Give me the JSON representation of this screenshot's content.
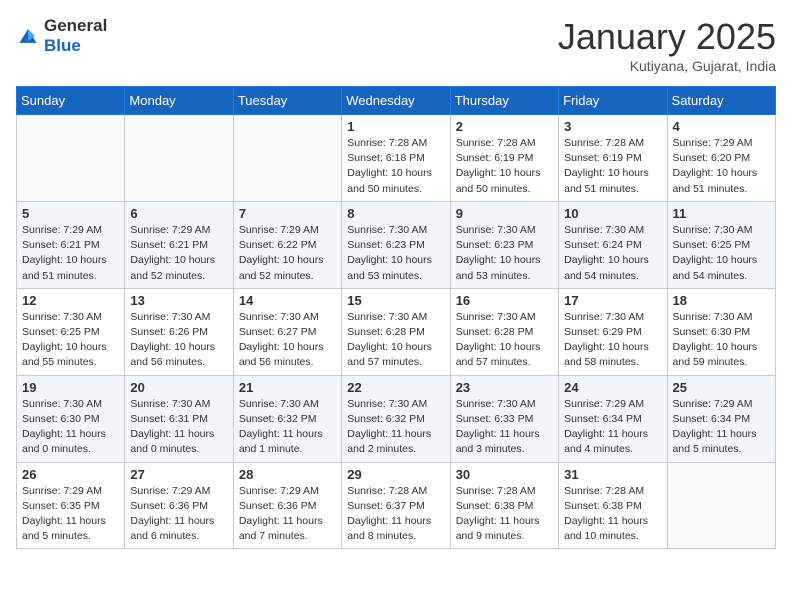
{
  "header": {
    "logo": {
      "general": "General",
      "blue": "Blue"
    },
    "title": "January 2025",
    "location": "Kutiyana, Gujarat, India"
  },
  "weekdays": [
    "Sunday",
    "Monday",
    "Tuesday",
    "Wednesday",
    "Thursday",
    "Friday",
    "Saturday"
  ],
  "weeks": [
    [
      {
        "day": "",
        "empty": true
      },
      {
        "day": "",
        "empty": true
      },
      {
        "day": "",
        "empty": true
      },
      {
        "day": "1",
        "sunrise": "7:28 AM",
        "sunset": "6:18 PM",
        "daylight": "10 hours and 50 minutes."
      },
      {
        "day": "2",
        "sunrise": "7:28 AM",
        "sunset": "6:19 PM",
        "daylight": "10 hours and 50 minutes."
      },
      {
        "day": "3",
        "sunrise": "7:28 AM",
        "sunset": "6:19 PM",
        "daylight": "10 hours and 51 minutes."
      },
      {
        "day": "4",
        "sunrise": "7:29 AM",
        "sunset": "6:20 PM",
        "daylight": "10 hours and 51 minutes."
      }
    ],
    [
      {
        "day": "5",
        "sunrise": "7:29 AM",
        "sunset": "6:21 PM",
        "daylight": "10 hours and 51 minutes."
      },
      {
        "day": "6",
        "sunrise": "7:29 AM",
        "sunset": "6:21 PM",
        "daylight": "10 hours and 52 minutes."
      },
      {
        "day": "7",
        "sunrise": "7:29 AM",
        "sunset": "6:22 PM",
        "daylight": "10 hours and 52 minutes."
      },
      {
        "day": "8",
        "sunrise": "7:30 AM",
        "sunset": "6:23 PM",
        "daylight": "10 hours and 53 minutes."
      },
      {
        "day": "9",
        "sunrise": "7:30 AM",
        "sunset": "6:23 PM",
        "daylight": "10 hours and 53 minutes."
      },
      {
        "day": "10",
        "sunrise": "7:30 AM",
        "sunset": "6:24 PM",
        "daylight": "10 hours and 54 minutes."
      },
      {
        "day": "11",
        "sunrise": "7:30 AM",
        "sunset": "6:25 PM",
        "daylight": "10 hours and 54 minutes."
      }
    ],
    [
      {
        "day": "12",
        "sunrise": "7:30 AM",
        "sunset": "6:25 PM",
        "daylight": "10 hours and 55 minutes."
      },
      {
        "day": "13",
        "sunrise": "7:30 AM",
        "sunset": "6:26 PM",
        "daylight": "10 hours and 56 minutes."
      },
      {
        "day": "14",
        "sunrise": "7:30 AM",
        "sunset": "6:27 PM",
        "daylight": "10 hours and 56 minutes."
      },
      {
        "day": "15",
        "sunrise": "7:30 AM",
        "sunset": "6:28 PM",
        "daylight": "10 hours and 57 minutes."
      },
      {
        "day": "16",
        "sunrise": "7:30 AM",
        "sunset": "6:28 PM",
        "daylight": "10 hours and 57 minutes."
      },
      {
        "day": "17",
        "sunrise": "7:30 AM",
        "sunset": "6:29 PM",
        "daylight": "10 hours and 58 minutes."
      },
      {
        "day": "18",
        "sunrise": "7:30 AM",
        "sunset": "6:30 PM",
        "daylight": "10 hours and 59 minutes."
      }
    ],
    [
      {
        "day": "19",
        "sunrise": "7:30 AM",
        "sunset": "6:30 PM",
        "daylight": "11 hours and 0 minutes."
      },
      {
        "day": "20",
        "sunrise": "7:30 AM",
        "sunset": "6:31 PM",
        "daylight": "11 hours and 0 minutes."
      },
      {
        "day": "21",
        "sunrise": "7:30 AM",
        "sunset": "6:32 PM",
        "daylight": "11 hours and 1 minute."
      },
      {
        "day": "22",
        "sunrise": "7:30 AM",
        "sunset": "6:32 PM",
        "daylight": "11 hours and 2 minutes."
      },
      {
        "day": "23",
        "sunrise": "7:30 AM",
        "sunset": "6:33 PM",
        "daylight": "11 hours and 3 minutes."
      },
      {
        "day": "24",
        "sunrise": "7:29 AM",
        "sunset": "6:34 PM",
        "daylight": "11 hours and 4 minutes."
      },
      {
        "day": "25",
        "sunrise": "7:29 AM",
        "sunset": "6:34 PM",
        "daylight": "11 hours and 5 minutes."
      }
    ],
    [
      {
        "day": "26",
        "sunrise": "7:29 AM",
        "sunset": "6:35 PM",
        "daylight": "11 hours and 5 minutes."
      },
      {
        "day": "27",
        "sunrise": "7:29 AM",
        "sunset": "6:36 PM",
        "daylight": "11 hours and 6 minutes."
      },
      {
        "day": "28",
        "sunrise": "7:29 AM",
        "sunset": "6:36 PM",
        "daylight": "11 hours and 7 minutes."
      },
      {
        "day": "29",
        "sunrise": "7:28 AM",
        "sunset": "6:37 PM",
        "daylight": "11 hours and 8 minutes."
      },
      {
        "day": "30",
        "sunrise": "7:28 AM",
        "sunset": "6:38 PM",
        "daylight": "11 hours and 9 minutes."
      },
      {
        "day": "31",
        "sunrise": "7:28 AM",
        "sunset": "6:38 PM",
        "daylight": "11 hours and 10 minutes."
      },
      {
        "day": "",
        "empty": true
      }
    ]
  ],
  "labels": {
    "sunrise": "Sunrise:",
    "sunset": "Sunset:",
    "daylight": "Daylight:"
  }
}
